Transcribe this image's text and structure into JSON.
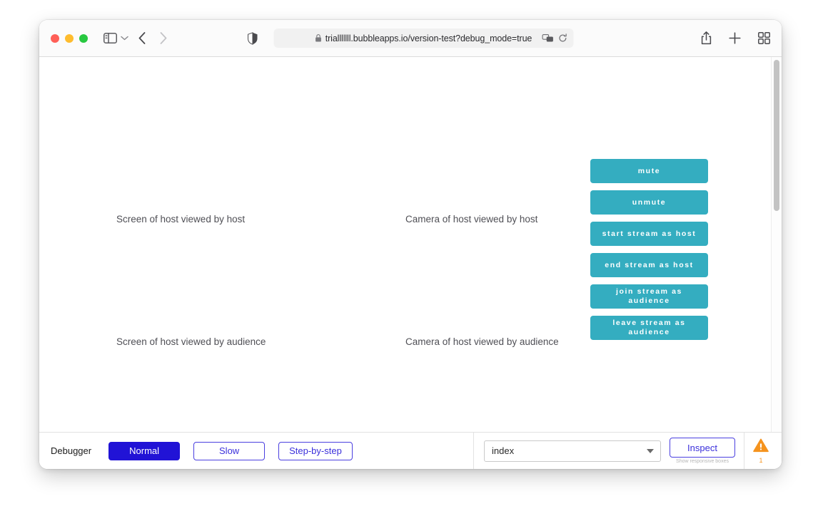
{
  "browser": {
    "traffic_lights": [
      "close",
      "minimize",
      "maximize"
    ],
    "sidebar_toggle_icon": "sidebar-icon",
    "sidebar_chevron_icon": "chevron-down-icon",
    "back_icon": "chevron-left-icon",
    "forward_icon": "chevron-right-icon",
    "shield_icon": "shield-icon",
    "lock_icon": "lock-icon",
    "url": "trialllllll.bubbleapps.io/version-test?debug_mode=true",
    "reader_icon": "translate-icon",
    "reload_icon": "reload-icon",
    "share_icon": "share-icon",
    "new_tab_icon": "plus-icon",
    "tab_overview_icon": "tab-grid-icon"
  },
  "page": {
    "placeholders": [
      {
        "id": "screen-host",
        "text": "Screen of host viewed by host"
      },
      {
        "id": "camera-host",
        "text": "Camera of host viewed by host"
      },
      {
        "id": "screen-audience",
        "text": "Screen of host viewed by audience"
      },
      {
        "id": "camera-audience",
        "text": "Camera of host viewed by audience"
      }
    ],
    "action_buttons": [
      {
        "id": "mute",
        "label": "mute"
      },
      {
        "id": "unmute",
        "label": "unmute"
      },
      {
        "id": "start-stream",
        "label": "start stream as host"
      },
      {
        "id": "end-stream",
        "label": "end stream as host"
      },
      {
        "id": "join-stream",
        "label": "join stream as audience"
      },
      {
        "id": "leave-stream",
        "label": "leave stream as audience"
      }
    ],
    "accent_color": "#34adc0"
  },
  "debugger": {
    "label": "Debugger",
    "speed_buttons": [
      {
        "id": "normal",
        "label": "Normal",
        "active": true
      },
      {
        "id": "slow",
        "label": "Slow",
        "active": false
      },
      {
        "id": "step-by-step",
        "label": "Step-by-step",
        "active": false
      }
    ],
    "page_select": {
      "value": "index",
      "arrow_icon": "chevron-down-icon"
    },
    "inspect": {
      "label": "Inspect",
      "sublabel": "Show responsive boxes"
    },
    "warning": {
      "icon": "warning-triangle-icon",
      "count": "1",
      "color": "#f5931e"
    },
    "active_color": "#2113d6"
  }
}
